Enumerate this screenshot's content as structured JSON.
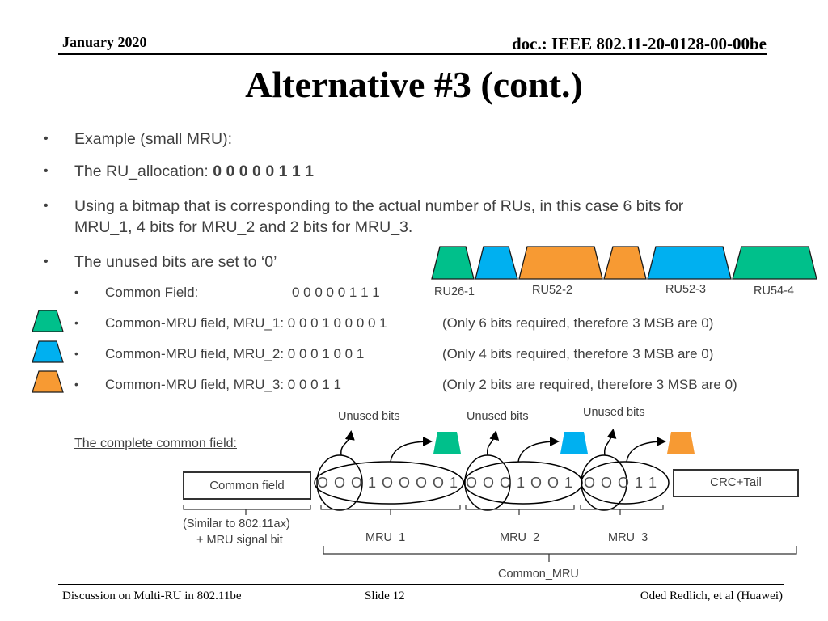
{
  "header": {
    "date": "January 2020",
    "doc_id": "doc.: IEEE 802.11-20-0128-00-00be"
  },
  "title": "Alternative #3 (cont.)",
  "bullets": [
    {
      "text": "Example (small MRU):"
    },
    {
      "text": "The RU_allocation: ",
      "value": "0 0 0 0 0 1 1 1"
    },
    {
      "line1": "Using a bitmap that is corresponding to the actual number of RUs, in this case 6 bits for",
      "line2": "MRU_1, 4 bits for MRU_2 and 2 bits for MRU_3."
    },
    {
      "text": "The unused bits are set to ‘0’"
    }
  ],
  "sub_bullets": [
    {
      "label": "Common Field:",
      "bits": "0 0 0 0 0 1 1 1",
      "note": ""
    },
    {
      "label": "Common-MRU field, MRU_1: 0 0 0 1 0 0 0 0 1",
      "note": "(Only 6 bits required, therefore 3 MSB are 0)",
      "color": "green"
    },
    {
      "label": "Common-MRU field, MRU_2: 0 0 0 1 0 0 1",
      "note": "(Only 4 bits required, therefore 3 MSB are 0)",
      "color": "blue"
    },
    {
      "label": "Common-MRU field, MRU_3: 0 0 0 1 1",
      "note": "(Only 2 bits are required, therefore 3 MSB are 0)",
      "color": "orange"
    }
  ],
  "colors": {
    "green": "#00C08B",
    "blue": "#00B0F0",
    "orange": "#F79A33",
    "outline": "#1a1a1a"
  },
  "ru_row": {
    "shapes": [
      "green",
      "blue",
      "orange",
      "orange",
      "blue",
      "green"
    ],
    "labels": [
      "RU26-1",
      "RU52-2",
      "RU52-3",
      "RU54-4"
    ]
  },
  "diagram": {
    "heading": "The complete common field:",
    "common_field_box": "Common field",
    "crc_box": "CRC+Tail",
    "bit_string": {
      "mru1": "O O O 1 O O O O 1",
      "mru2": "O O O 1 O O 1",
      "mru3": "O O O 1 1"
    },
    "unused_label": "Unused bits",
    "common_note_line1": "(Similar to 802.11ax)",
    "common_note_line2": "+ MRU signal bit",
    "mru_labels": [
      "MRU_1",
      "MRU_2",
      "MRU_3"
    ],
    "common_mru_label": "Common_MRU"
  },
  "footer": {
    "left": "Discussion on Multi-RU in 802.11be",
    "center": "Slide 12",
    "right": "Oded Redlich, et al (Huawei)"
  }
}
